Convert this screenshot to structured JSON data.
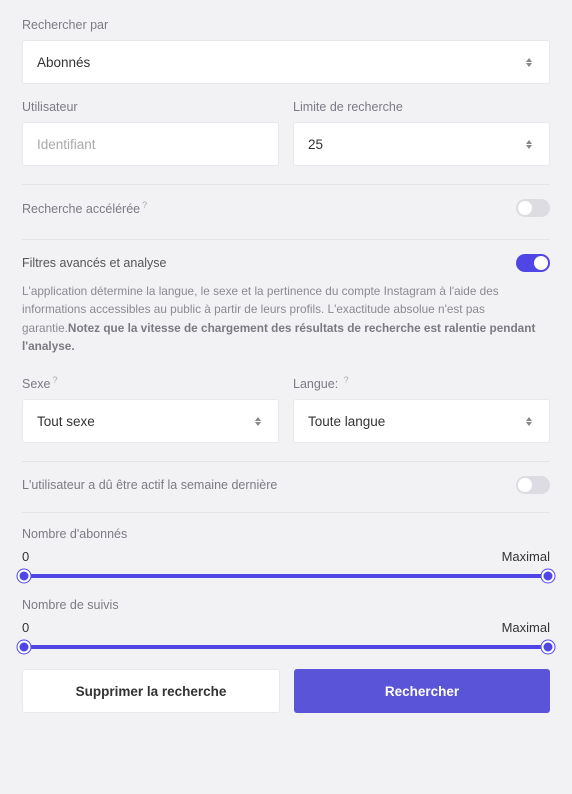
{
  "searchBy": {
    "label": "Rechercher par",
    "value": "Abonnés"
  },
  "user": {
    "label": "Utilisateur",
    "placeholder": "Identifiant"
  },
  "limit": {
    "label": "Limite de recherche",
    "value": "25"
  },
  "accelerated": {
    "label": "Recherche accélérée",
    "q": "?",
    "on": false
  },
  "advanced": {
    "label": "Filtres avancés et analyse",
    "on": true,
    "desc_a": "L'application détermine la langue, le sexe et la pertinence du compte Instagram à l'aide des informations accessibles au public à partir de leurs profils. L'exactitude absolue n'est pas garantie.",
    "desc_b": "Notez que la vitesse de chargement des résultats de recherche est ralentie pendant l'analyse."
  },
  "sex": {
    "label": "Sexe",
    "q": "?",
    "value": "Tout sexe"
  },
  "lang": {
    "label": "Langue:",
    "q": "?",
    "value": "Toute langue"
  },
  "active": {
    "label": "L'utilisateur a dû être actif la semaine dernière",
    "on": false
  },
  "followers": {
    "label": "Nombre d'abonnés",
    "min": "0",
    "max": "Maximal"
  },
  "following": {
    "label": "Nombre de suivis",
    "min": "0",
    "max": "Maximal"
  },
  "buttons": {
    "clear": "Supprimer la recherche",
    "search": "Rechercher"
  }
}
